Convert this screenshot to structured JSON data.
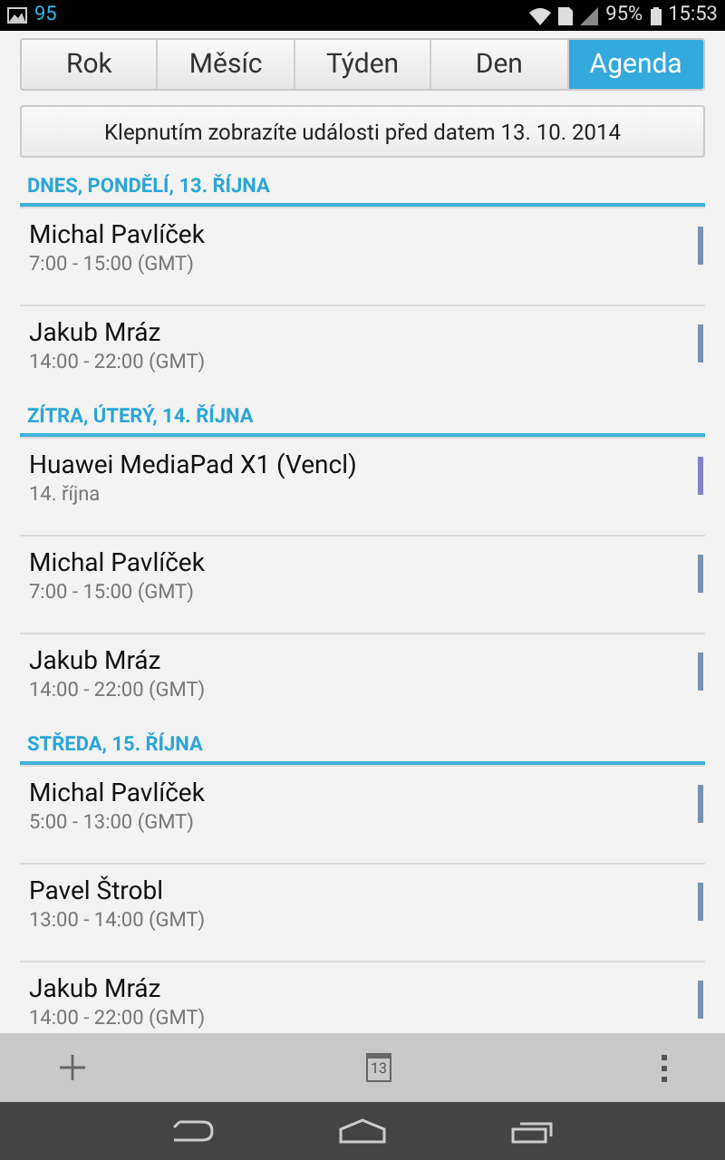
{
  "status_bar": {
    "notification": "95",
    "battery": "95%",
    "time": "15:53"
  },
  "tabs": [
    {
      "label": "Rok",
      "selected": false
    },
    {
      "label": "Měsíc",
      "selected": false
    },
    {
      "label": "Týden",
      "selected": false
    },
    {
      "label": "Den",
      "selected": false
    },
    {
      "label": "Agenda",
      "selected": true
    }
  ],
  "earlier_button": "Klepnutím zobrazíte události před datem 13. 10. 2014",
  "sections": [
    {
      "heading": "DNES, PONDĚLÍ, 13. ŘÍJNA",
      "events": [
        {
          "title": "Michal Pavlíček",
          "time": "7:00 - 15:00 (GMT)",
          "color": "#7693b3"
        },
        {
          "title": "Jakub Mráz",
          "time": "14:00 - 22:00 (GMT)",
          "color": "#7693b3"
        }
      ]
    },
    {
      "heading": "ZÍTRA, ÚTERÝ, 14. ŘÍJNA",
      "events": [
        {
          "title": "Huawei MediaPad X1 (Vencl)",
          "time": "14. října",
          "color": "#8580c8"
        },
        {
          "title": "Michal Pavlíček",
          "time": "7:00 - 15:00 (GMT)",
          "color": "#7693b3"
        },
        {
          "title": "Jakub Mráz",
          "time": "14:00 - 22:00 (GMT)",
          "color": "#7693b3"
        }
      ]
    },
    {
      "heading": "STŘEDA, 15. ŘÍJNA",
      "events": [
        {
          "title": "Michal Pavlíček",
          "time": "5:00 - 13:00 (GMT)",
          "color": "#7693b3"
        },
        {
          "title": "Pavel Štrobl",
          "time": "13:00 - 14:00 (GMT)",
          "color": "#7693b3"
        },
        {
          "title": "Jakub Mráz",
          "time": "14:00 - 22:00 (GMT)",
          "color": "#7693b3"
        }
      ]
    }
  ],
  "toolbar": {
    "today_day": "13"
  }
}
